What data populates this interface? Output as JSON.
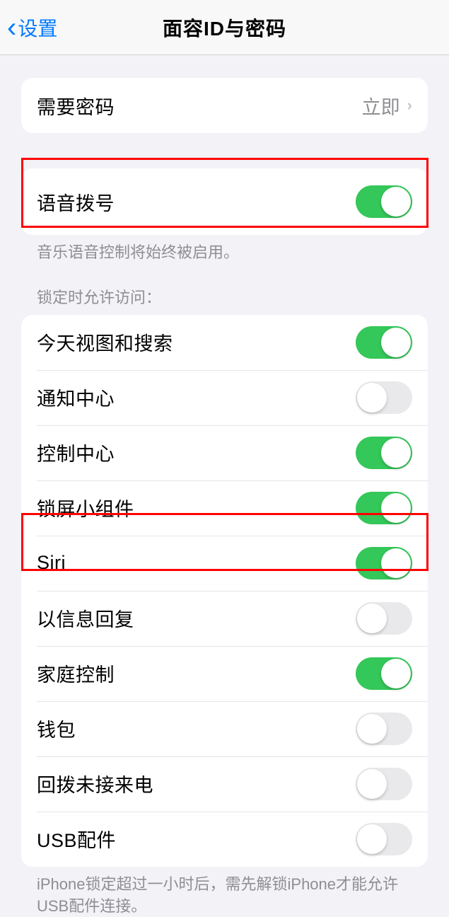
{
  "nav": {
    "back": "设置",
    "title": "面容ID与密码"
  },
  "group1": {
    "requirePasscode": {
      "label": "需要密码",
      "value": "立即"
    }
  },
  "group2": {
    "voiceDial": {
      "label": "语音拨号",
      "on": true
    },
    "footnote": "音乐语音控制将始终被启用。"
  },
  "group3": {
    "header": "锁定时允许访问：",
    "items": [
      {
        "label": "今天视图和搜索",
        "on": true
      },
      {
        "label": "通知中心",
        "on": false
      },
      {
        "label": "控制中心",
        "on": true
      },
      {
        "label": "锁屏小组件",
        "on": true
      },
      {
        "label": "Siri",
        "on": true
      },
      {
        "label": "以信息回复",
        "on": false
      },
      {
        "label": "家庭控制",
        "on": true
      },
      {
        "label": "钱包",
        "on": false
      },
      {
        "label": "回拨未接来电",
        "on": false
      },
      {
        "label": "USB配件",
        "on": false
      }
    ],
    "footnote": "iPhone锁定超过一小时后，需先解锁iPhone才能允许USB配件连接。"
  }
}
